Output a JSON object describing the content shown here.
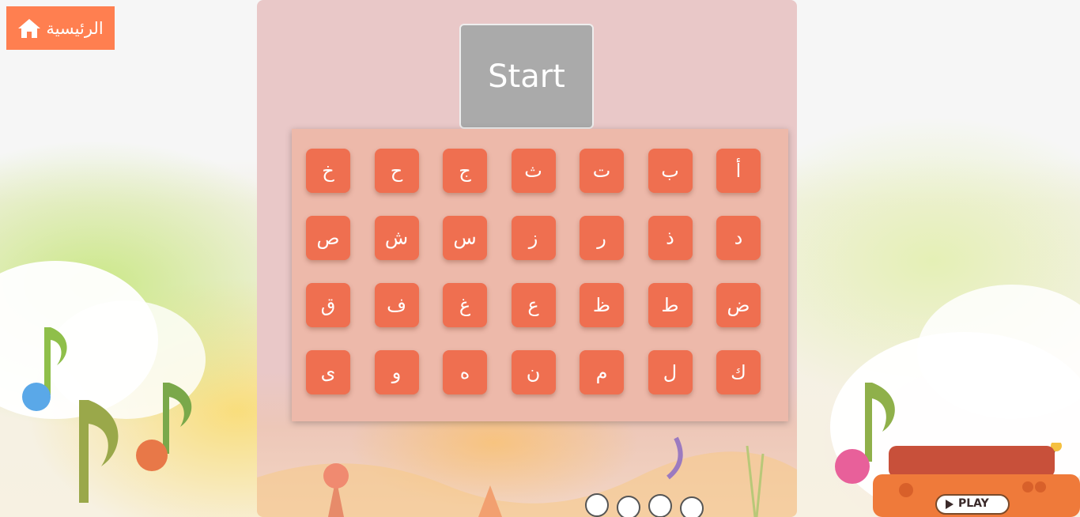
{
  "home": {
    "label": "الرئيسية",
    "icon": "home-icon"
  },
  "start": {
    "label": "Start"
  },
  "letters": [
    "أ",
    "ب",
    "ت",
    "ث",
    "ج",
    "ح",
    "خ",
    "د",
    "ذ",
    "ر",
    "ز",
    "س",
    "ش",
    "ص",
    "ض",
    "ط",
    "ظ",
    "ع",
    "غ",
    "ف",
    "ق",
    "ك",
    "ل",
    "م",
    "ن",
    "ه",
    "و",
    "ى"
  ],
  "radio": {
    "play_label": "PLAY"
  },
  "colors": {
    "accent": "#ff7f50",
    "letter_tile": "#ef6f50",
    "board": "#edb9aa",
    "start_button": "#aaaaaa"
  }
}
